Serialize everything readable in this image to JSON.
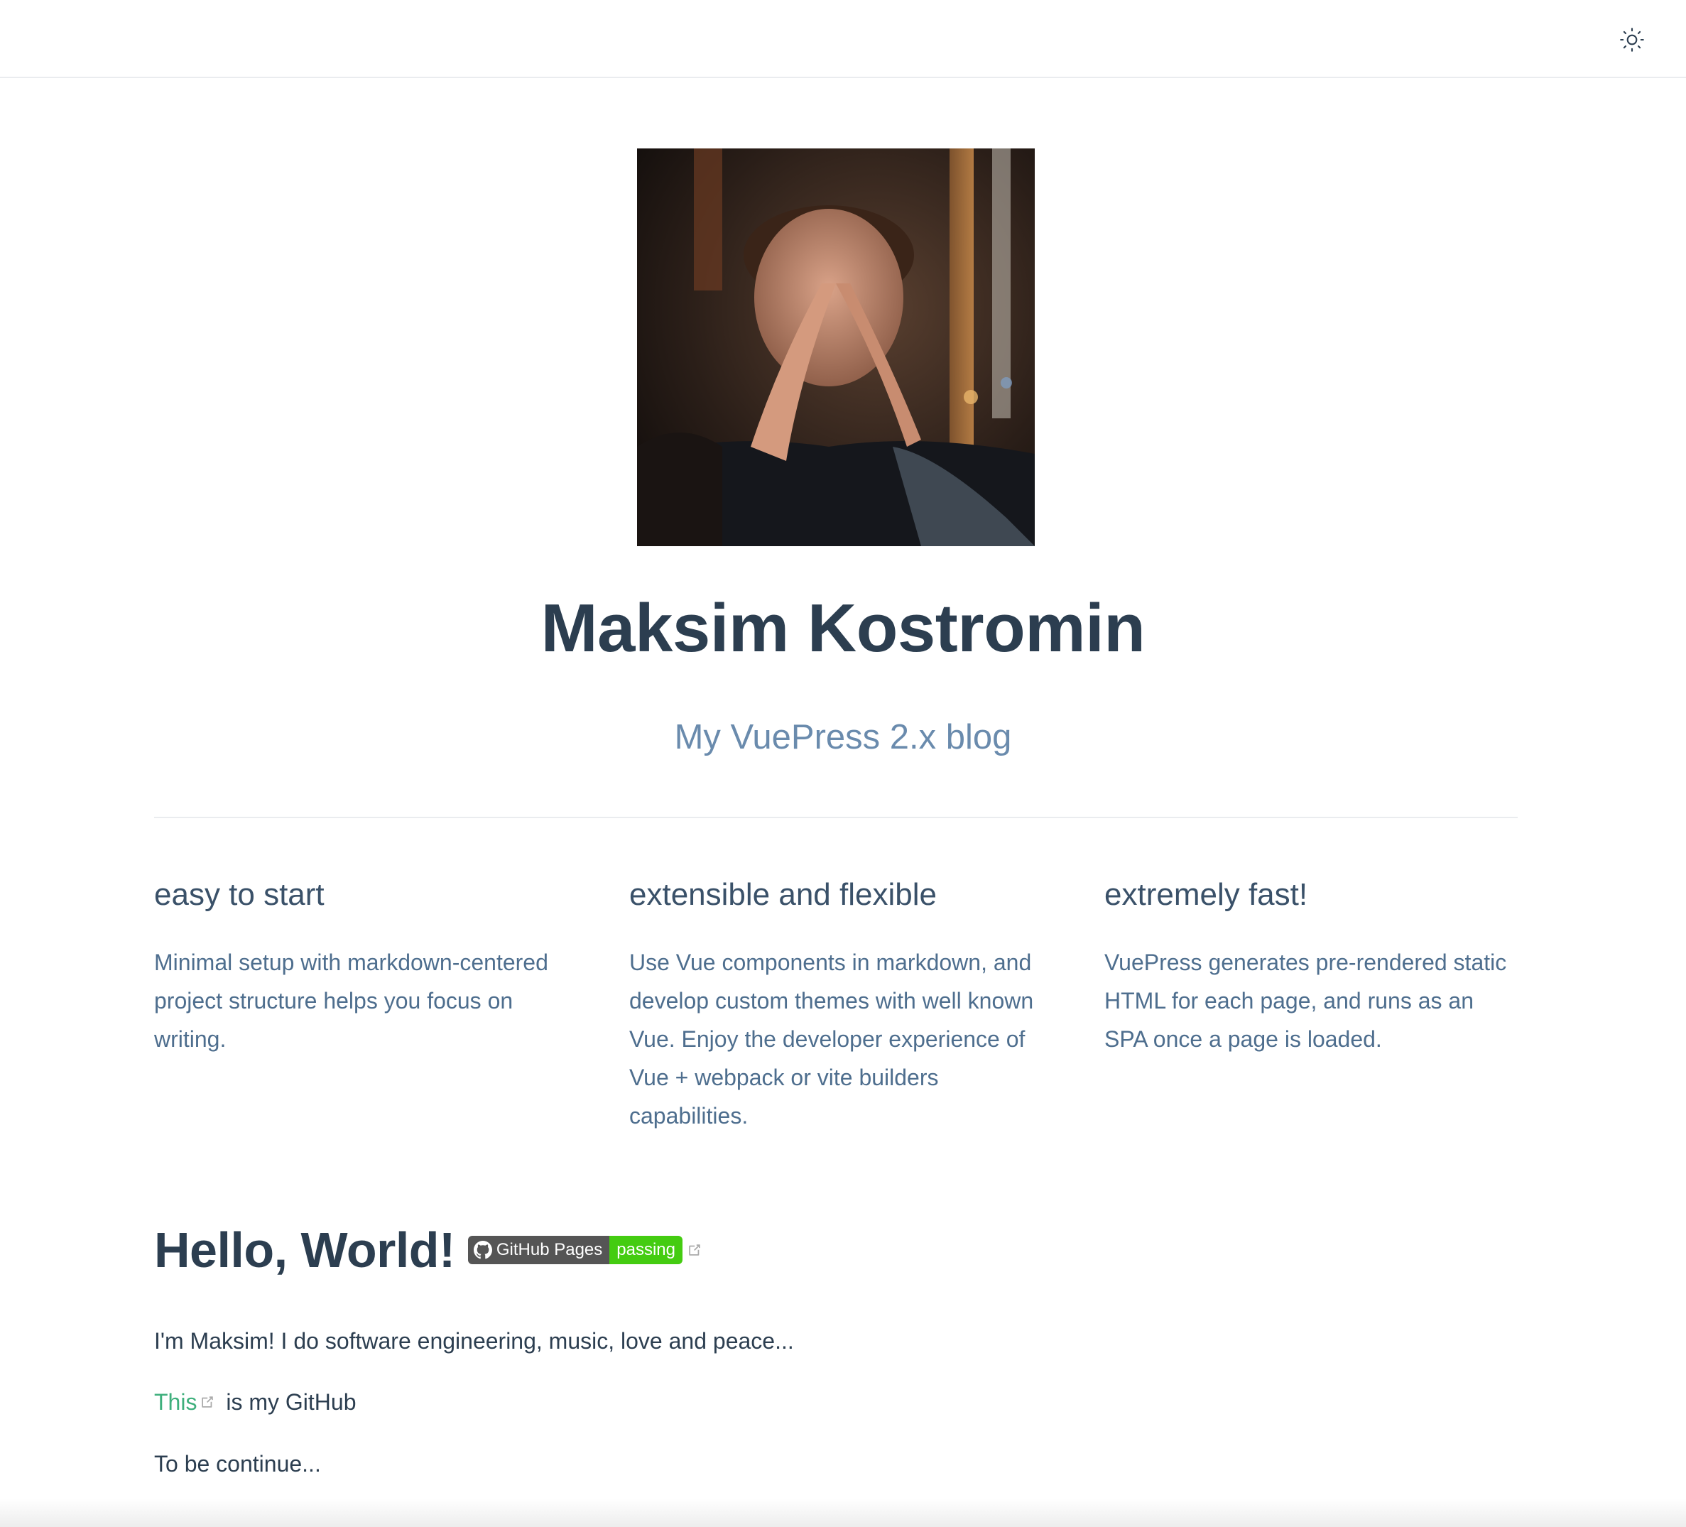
{
  "navbar": {
    "theme_toggle_icon": "sun-icon"
  },
  "hero": {
    "image_alt": "portrait photo",
    "title": "Maksim Kostromin",
    "description": "My VuePress 2.x blog"
  },
  "features": [
    {
      "title": "easy to start",
      "details": "Minimal setup with markdown-centered project structure helps you focus on writing."
    },
    {
      "title": "extensible and flexible",
      "details": "Use Vue components in markdown, and develop custom themes with well known Vue. Enjoy the developer experience of Vue + webpack or vite builders capabilities."
    },
    {
      "title": "extremely fast!",
      "details": "VuePress generates pre-rendered static HTML for each page, and runs as an SPA once a page is loaded."
    }
  ],
  "content": {
    "heading": "Hello, World!",
    "badge": {
      "label": "GitHub Pages",
      "status": "passing",
      "label_color": "#555555",
      "status_color": "#44cc11"
    },
    "intro": "I'm Maksim! I do software engineering, music, love and peace...",
    "github_link_text": "This",
    "github_suffix": " is my GitHub",
    "outro": "To be continue..."
  },
  "colors": {
    "accent": "#3eaf7c",
    "text": "#2c3e50",
    "description": "#6a8bad"
  }
}
